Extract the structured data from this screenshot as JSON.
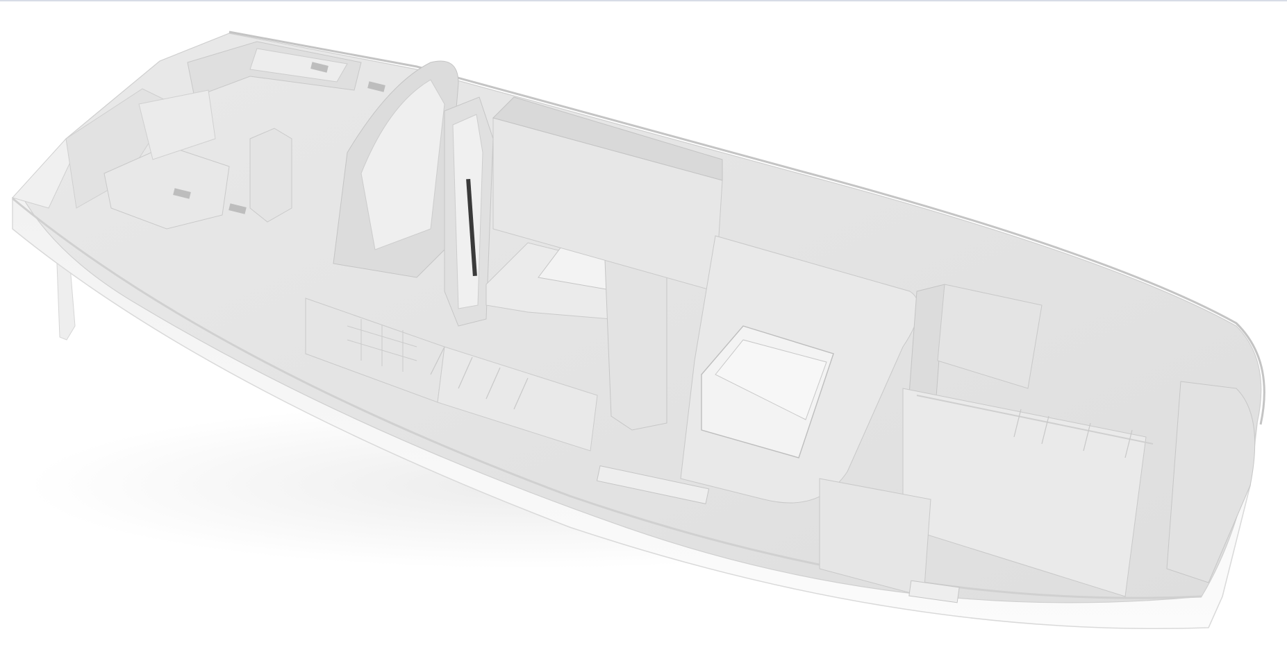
{
  "viewport": {
    "background_color": "#ffffff",
    "top_border_color": "#d7dce6",
    "display_mode": "rendered"
  },
  "model": {
    "subject": "boat-hull-interior-cutaway",
    "palette": {
      "hull": "#f4f4f4",
      "hull_side": "#f7f7f7",
      "deck": "#e6e6e6",
      "bulkhead": "#dcdcdc",
      "shadow": "#c9c9c9",
      "dark_detail": "#3a3a3a"
    }
  }
}
